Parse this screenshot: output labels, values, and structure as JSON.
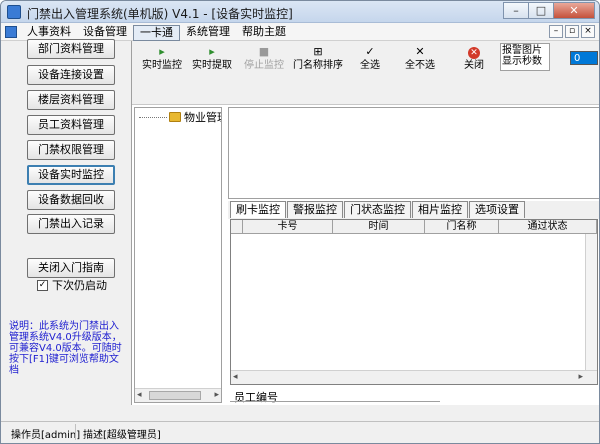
{
  "window": {
    "title": "门禁出入管理系统(单机版) V4.1 - [设备实时监控]",
    "controls": {
      "minimize": "–",
      "maximize": "□",
      "close": "✕"
    }
  },
  "menu": {
    "items": [
      "人事资料",
      "设备管理",
      "一卡通",
      "系统管理",
      "帮助主题"
    ],
    "active_index": 2,
    "mdi": {
      "minimize": "–",
      "restore": "▫",
      "close": "×"
    }
  },
  "sidebar": {
    "buttons": [
      "部门资料管理",
      "设备连接设置",
      "楼层资料管理",
      "员工资料管理",
      "门禁权限管理",
      "设备实时监控",
      "设备数据回收",
      "门禁出入记录"
    ],
    "active_index": 5,
    "restart_checkbox": {
      "label": "下次仍启动",
      "checked": true,
      "mark": "✓"
    },
    "guide_button": "关闭入门指南",
    "info": "说明：此系统为门禁出入管理系统V4.0升级版本，可兼容V4.0版本。可随时按下[F1]键可浏览帮助文档"
  },
  "toolbar": {
    "tools": [
      {
        "label": "实时监控",
        "glyph": "▸",
        "icon": "play-icon",
        "enabled": true
      },
      {
        "label": "实时提取",
        "glyph": "▸",
        "icon": "play-icon",
        "enabled": true
      },
      {
        "label": "停止监控",
        "glyph": "■",
        "icon": "stop-icon",
        "enabled": false
      },
      {
        "label": "门名称排序",
        "glyph": "⊞",
        "icon": "sort-icon",
        "enabled": true
      },
      {
        "label": "全选",
        "glyph": "✓",
        "icon": "check-icon",
        "enabled": true
      },
      {
        "label": "全不选",
        "glyph": "✕",
        "icon": "uncheck-icon",
        "enabled": true
      },
      {
        "label": "关闭",
        "glyph": "✕",
        "icon": "close-circle-icon",
        "enabled": true
      }
    ],
    "alarm_label": "报警图片显示秒数",
    "alarm_value": "0"
  },
  "tree": {
    "root": "物业管理处",
    "scroll_left": "◂",
    "scroll_right": "▸",
    "scroll_grip": "⁞⁞⁞"
  },
  "tabs": [
    "刷卡监控",
    "警报监控",
    "门状态监控",
    "相片监控",
    "选项设置"
  ],
  "active_tab": 0,
  "grid": {
    "columns": [
      "卡号",
      "时间",
      "门名称",
      "通过状态"
    ],
    "scroll_left": "◂",
    "scroll_right": "▸"
  },
  "employee_label": "员工编号",
  "status": {
    "operator": "操作员[admin]",
    "description": "描述[超级管理员]"
  }
}
